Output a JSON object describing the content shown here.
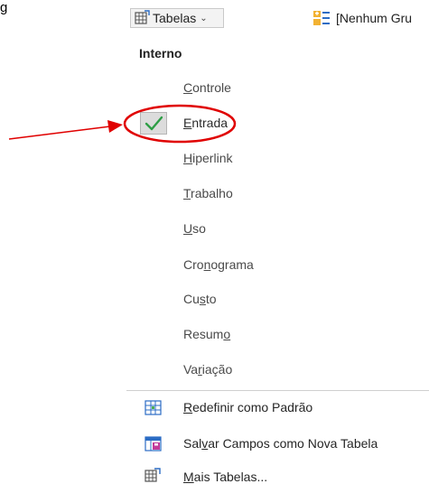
{
  "fragment_text": "g",
  "toolbar": {
    "tables_label": "Tabelas",
    "group_label": "[Nenhum Gru"
  },
  "menu": {
    "section": "Interno",
    "items": [
      {
        "pre": "",
        "u": "C",
        "post": "ontrole"
      },
      {
        "pre": "",
        "u": "E",
        "post": "ntrada"
      },
      {
        "pre": "",
        "u": "H",
        "post": "iperlink"
      },
      {
        "pre": "",
        "u": "T",
        "post": "rabalho"
      },
      {
        "pre": "",
        "u": "U",
        "post": "so"
      },
      {
        "pre": "Cro",
        "u": "n",
        "post": "ograma"
      },
      {
        "pre": "Cu",
        "u": "s",
        "post": "to"
      },
      {
        "pre": "Resum",
        "u": "o",
        "post": ""
      },
      {
        "pre": "Va",
        "u": "r",
        "post": "iação"
      }
    ],
    "commands": [
      {
        "pre": "",
        "u": "R",
        "post": "edefinir como Padrão"
      },
      {
        "pre": "Sal",
        "u": "v",
        "post": "ar Campos como Nova Tabela"
      },
      {
        "pre": "",
        "u": "M",
        "post": "ais Tabelas..."
      }
    ]
  },
  "colors": {
    "annotation": "#e00000",
    "check": "#2e9e46"
  }
}
